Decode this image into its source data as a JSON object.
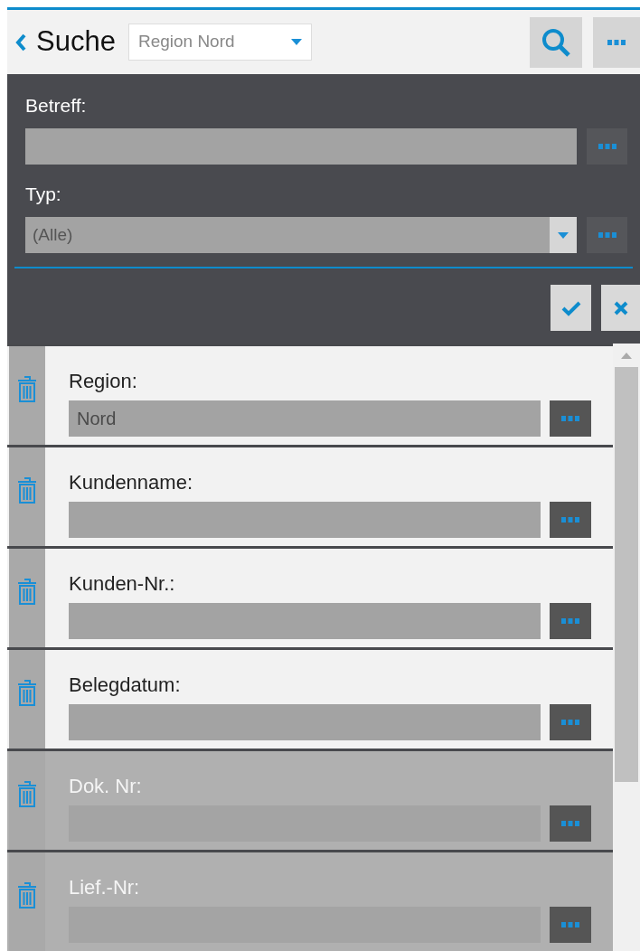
{
  "header": {
    "title": "Suche",
    "filter": {
      "value": "Region Nord"
    }
  },
  "criteria": [
    {
      "label": "Betreff:",
      "kind": "text"
    },
    {
      "label": "Typ:",
      "kind": "select",
      "value": "(Alle)"
    }
  ],
  "fields": [
    {
      "label": "Region:",
      "value": "Nord",
      "disabled": false
    },
    {
      "label": "Kundenname:",
      "disabled": false
    },
    {
      "label": "Kunden-Nr.:",
      "disabled": false
    },
    {
      "label": "Belegdatum:",
      "disabled": false
    },
    {
      "label": "Dok. Nr:",
      "disabled": true
    },
    {
      "label": "Lief.-Nr:",
      "disabled": true
    }
  ]
}
